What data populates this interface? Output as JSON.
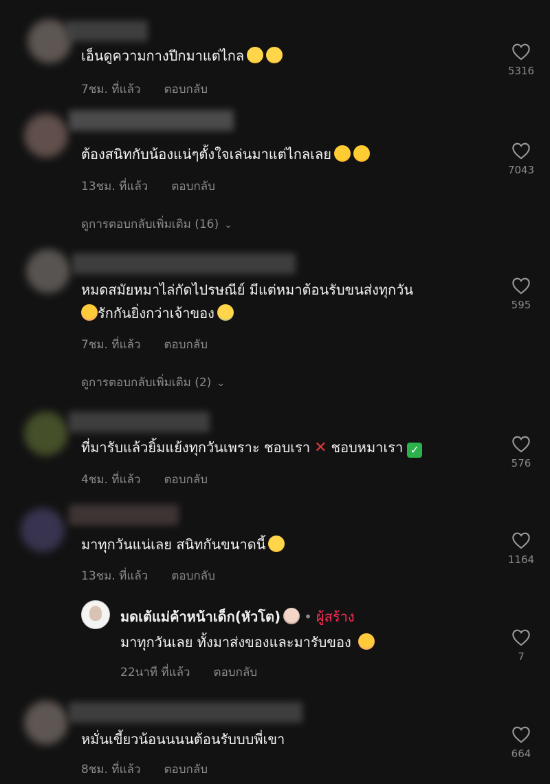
{
  "comments": [
    {
      "text": "เอ็นดูความกางปีกมาแต่ไกล",
      "emoji": [
        "laugh",
        "laugh"
      ],
      "time": "7ชม. ที่แล้ว",
      "reply": "ตอบกลับ",
      "likes": "5316"
    },
    {
      "text": "ต้องสนิทกับน้องแน่ๆตั้งใจเล่นมาแต่ไกลเลย",
      "emoji": [
        "smile",
        "smile"
      ],
      "time": "13ชม. ที่แล้ว",
      "reply": "ตอบกลับ",
      "likes": "7043",
      "more": "ดูการตอบกลับเพิ่มเติม (16)"
    },
    {
      "text_line1": "หมดสมัยหมาไล่กัดไปรษณีย์ มีแต่หมาต้อนรับขนส่งทุกวัน",
      "text_line2": "รักกันยิ่งกว่าเจ้าของ",
      "time": "7ชม. ที่แล้ว",
      "reply": "ตอบกลับ",
      "likes": "595",
      "more": "ดูการตอบกลับเพิ่มเติม (2)"
    },
    {
      "text_a": "ที่มารับแล้วยิ้มแย้งทุกวันเพราะ ชอบเรา",
      "text_b": "ชอบหมาเรา",
      "time": "4ชม. ที่แล้ว",
      "reply": "ตอบกลับ",
      "likes": "576"
    },
    {
      "text": "มาทุกวันแน่เลย สนิทกันขนาดนี้",
      "time": "13ชม. ที่แล้ว",
      "reply": "ตอบกลับ",
      "likes": "1164"
    },
    {
      "text": "หมั่นเขี้ยวน้อนนนนต้อนรับบบพี่เขา",
      "time": "8ชม. ที่แล้ว",
      "reply": "ตอบกลับ",
      "likes": "664"
    }
  ],
  "creator_reply": {
    "name": "มดเต้แม่ค้าหน้าเด็ก(หัวโต)",
    "badge": "ผู้สร้าง",
    "separator": "•",
    "text": "มาทุกวันเลย ทั้งมาส่งของและมารับของ",
    "time": "22นาที ที่แล้ว",
    "reply": "ตอบกลับ",
    "likes": "7"
  },
  "icons": {
    "like": "heart-outline-icon",
    "chevron": "chevron-down-icon"
  },
  "colors": {
    "background": "#121212",
    "meta": "#8a8a8a",
    "creator_badge": "#fe2c55"
  }
}
